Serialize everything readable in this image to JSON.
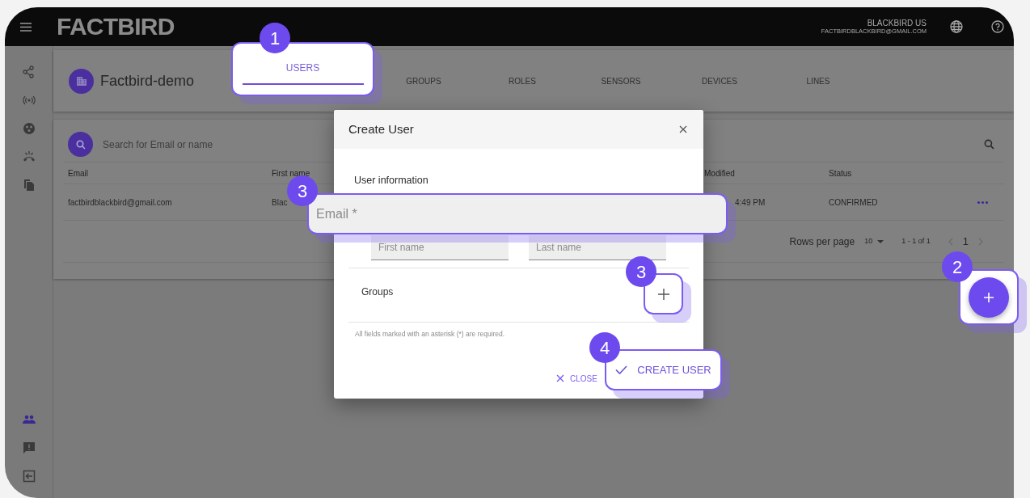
{
  "header": {
    "logo": "FACTBIRD",
    "account_name": "BLACKBIRD US",
    "account_email": "FACTBIRDBLACKBIRD@GMAIL.COM"
  },
  "sidebar": {
    "items": [
      {
        "kind": "network",
        "selected": false
      },
      {
        "kind": "broadcast",
        "selected": false
      },
      {
        "kind": "dashboard",
        "selected": false
      },
      {
        "kind": "alarm",
        "selected": false
      },
      {
        "kind": "documents",
        "selected": false
      },
      {
        "kind": "users",
        "selected": true
      },
      {
        "kind": "feedback",
        "selected": false
      },
      {
        "kind": "logout",
        "selected": false
      }
    ]
  },
  "company": {
    "name": "Factbird-demo"
  },
  "tabs": [
    {
      "label": "USERS",
      "selected": true
    },
    {
      "label": "GROUPS",
      "selected": false
    },
    {
      "label": "ROLES",
      "selected": false
    },
    {
      "label": "SENSORS",
      "selected": false
    },
    {
      "label": "DEVICES",
      "selected": false
    },
    {
      "label": "LINES",
      "selected": false
    }
  ],
  "search": {
    "placeholder": "Search for Email or name"
  },
  "table": {
    "columns": [
      "Email",
      "First name",
      "Modified",
      "Status"
    ],
    "rows": [
      {
        "cells": [
          "factbirdblackbird@gmail.com",
          "Blac",
          "4:49 PM",
          "CONFIRMED"
        ]
      }
    ]
  },
  "pagination": {
    "rows_per_page_label": "Rows per page",
    "rows_per_page": "10",
    "range": "1 - 1 of 1",
    "page": "1"
  },
  "dialog": {
    "title": "Create User",
    "section": "User information",
    "email": {
      "placeholder": "Email *"
    },
    "first_name": {
      "placeholder": "First name"
    },
    "last_name": {
      "placeholder": "Last name"
    },
    "groups_label": "Groups",
    "note": "All fields marked with an asterisk (*) are required.",
    "close": "CLOSE",
    "create": "CREATE USER"
  },
  "callouts": [
    {
      "number": "1"
    },
    {
      "number": "3"
    },
    {
      "number": "3"
    },
    {
      "number": "2"
    },
    {
      "number": "4"
    }
  ]
}
